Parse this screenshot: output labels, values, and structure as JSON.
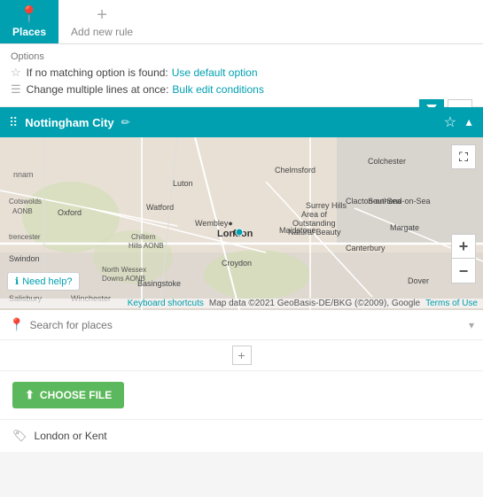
{
  "tabs": [
    {
      "label": "Places",
      "icon": "📍",
      "active": true
    },
    {
      "label": "Add new rule",
      "icon": "+",
      "active": false
    }
  ],
  "options": {
    "label": "Options",
    "row1": {
      "text": "If no matching option is found:",
      "link_text": "Use default option"
    },
    "row2": {
      "text": "Change multiple lines at once:",
      "link_text": "Bulk edit conditions"
    }
  },
  "toolbar": {
    "filter_icon": "≡",
    "funnel_icon": "⧩"
  },
  "rule": {
    "title": "Nottingham City",
    "has_edit_icon": true
  },
  "map": {
    "expand_title": "⛶",
    "zoom_in": "+",
    "zoom_out": "−",
    "footer_shortcuts": "Keyboard shortcuts",
    "footer_data": "Map data ©2021 GeoBasis-DE/BKG (©2009), Google",
    "footer_terms": "Terms of Use",
    "help_text": "Need help?"
  },
  "search": {
    "placeholder": "Search for places"
  },
  "file_section": {
    "button_label": "CHOOSE FILE"
  },
  "tag": {
    "label": "London or Kent",
    "icon": "🏷"
  }
}
